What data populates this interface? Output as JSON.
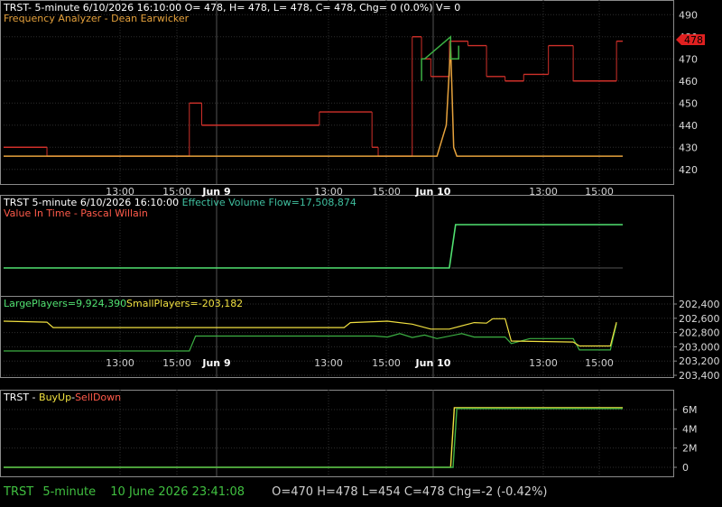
{
  "colors": {
    "background": "#000000",
    "panel_border": "#8a8a8a",
    "grid": "#2e2e2e",
    "axis_text": "#d8d8d8",
    "white": "#ffffff",
    "orange": "#e6a23c",
    "yellow": "#f0e040",
    "red": "#d0302a",
    "green": "#3cb043",
    "bright_green": "#50e070",
    "teal": "#3fbf9f",
    "salmon": "#ff5a4a",
    "status_green": "#40c040",
    "status_gray": "#cfcfcf"
  },
  "panel1": {
    "header": "TRST- 5-minute 6/10/2026 16:10:00 O= 478, H= 478, L= 478, C= 478, Chg= 0 (0.0%) V= 0",
    "subheader": "Frequency Analyzer - Dean Earwicker",
    "price_tag": "478"
  },
  "panel2": {
    "header_prefix": "TRST 5-minute  6/10/2026 16:10:00  ",
    "header_value": "Effective Volume Flow=17,508,874",
    "subheader": "Value In Time - Pascal Willain"
  },
  "panel3": {
    "large_label": "LargePlayers=9,924,390",
    "small_label": "SmallPlayers=-203,182"
  },
  "panel4": {
    "prefix": "TRST - ",
    "buy": "BuyUp",
    "dash": "-",
    "sell": "SellDown"
  },
  "status": {
    "symbol": "TRST",
    "interval": "5-minute",
    "datetime": "10 June 2026 23:41:08",
    "ohlc": "O=470  H=478  L=454  C=478  Chg=-2 (-0.42%)"
  },
  "chart_data": [
    {
      "type": "line",
      "title": "Frequency Analyzer - Dean Earwicker",
      "y_ticks": [
        420,
        430,
        440,
        450,
        460,
        470,
        480,
        490
      ],
      "ylim": [
        415,
        495
      ],
      "x_ticks": [
        "13:00",
        "15:00",
        "Jun 9",
        "13:00",
        "15:00",
        "Jun 10",
        "13:00",
        "15:00"
      ],
      "grid": true,
      "last_value": 478,
      "series": [
        {
          "color": "red",
          "kind": "price_steps",
          "segments": [
            {
              "x0": 0.0,
              "x1": 0.07,
              "y": 430
            },
            {
              "x0": 0.07,
              "x1": 0.3,
              "y": 426
            },
            {
              "x0": 0.3,
              "x1": 0.32,
              "y": 450
            },
            {
              "x0": 0.32,
              "x1": 0.51,
              "y": 440
            },
            {
              "x0": 0.51,
              "x1": 0.595,
              "y": 446
            },
            {
              "x0": 0.595,
              "x1": 0.605,
              "y": 430
            },
            {
              "x0": 0.605,
              "x1": 0.66,
              "y": 426
            },
            {
              "x0": 0.66,
              "x1": 0.675,
              "y": 480
            },
            {
              "x0": 0.675,
              "x1": 0.69,
              "y": 470
            },
            {
              "x0": 0.69,
              "x1": 0.72,
              "y": 462
            },
            {
              "x0": 0.72,
              "x1": 0.75,
              "y": 478
            },
            {
              "x0": 0.75,
              "x1": 0.78,
              "y": 476
            },
            {
              "x0": 0.78,
              "x1": 0.81,
              "y": 462
            },
            {
              "x0": 0.81,
              "x1": 0.84,
              "y": 460
            },
            {
              "x0": 0.84,
              "x1": 0.88,
              "y": 463
            },
            {
              "x0": 0.88,
              "x1": 0.92,
              "y": 476
            },
            {
              "x0": 0.92,
              "x1": 0.99,
              "y": 460
            },
            {
              "x0": 0.99,
              "x1": 1.0,
              "y": 478
            }
          ]
        },
        {
          "color": "orange",
          "kind": "analyzer",
          "points": [
            [
              0.0,
              426
            ],
            [
              0.7,
              426
            ],
            [
              0.715,
              440
            ],
            [
              0.722,
              476
            ],
            [
              0.727,
              430
            ],
            [
              0.732,
              426
            ],
            [
              1.0,
              426
            ]
          ]
        },
        {
          "color": "green",
          "kind": "steps",
          "points": [
            [
              0.675,
              460
            ],
            [
              0.675,
              470
            ],
            [
              0.68,
              470
            ],
            [
              0.722,
              480
            ],
            [
              0.722,
              470
            ],
            [
              0.735,
              470
            ],
            [
              0.735,
              476
            ]
          ]
        }
      ]
    },
    {
      "type": "line",
      "title": "Effective Volume Flow",
      "value": 17508874,
      "series": [
        {
          "name": "Effective Volume Flow",
          "color": "bright_green",
          "points": [
            [
              0.0,
              0
            ],
            [
              0.72,
              0
            ],
            [
              0.73,
              17508874
            ],
            [
              1.0,
              17508874
            ]
          ]
        }
      ]
    },
    {
      "type": "line",
      "title": "LargePlayers / SmallPlayers",
      "y_ticks": [
        "202,400",
        "202,600",
        "202,800",
        "203,000",
        "203,200",
        "203,400"
      ],
      "x_ticks": [
        "13:00",
        "15:00",
        "Jun 9",
        "13:00",
        "15:00",
        "Jun 10",
        "13:00",
        "15:00"
      ],
      "series": [
        {
          "name": "LargePlayers",
          "value": 9924390,
          "color": "green",
          "points": [
            [
              0.0,
              0.2
            ],
            [
              0.3,
              0.2
            ],
            [
              0.31,
              0.5
            ],
            [
              0.6,
              0.5
            ],
            [
              0.62,
              0.48
            ],
            [
              0.64,
              0.55
            ],
            [
              0.66,
              0.47
            ],
            [
              0.68,
              0.52
            ],
            [
              0.7,
              0.45
            ],
            [
              0.74,
              0.55
            ],
            [
              0.76,
              0.48
            ],
            [
              0.81,
              0.48
            ],
            [
              0.82,
              0.35
            ],
            [
              0.85,
              0.45
            ],
            [
              0.92,
              0.45
            ],
            [
              0.93,
              0.22
            ],
            [
              0.98,
              0.22
            ],
            [
              0.99,
              0.75
            ]
          ]
        },
        {
          "name": "SmallPlayers",
          "value": -203182,
          "color": "yellow",
          "points": [
            [
              0.0,
              0.8
            ],
            [
              0.07,
              0.78
            ],
            [
              0.08,
              0.67
            ],
            [
              0.55,
              0.67
            ],
            [
              0.56,
              0.77
            ],
            [
              0.62,
              0.8
            ],
            [
              0.66,
              0.74
            ],
            [
              0.69,
              0.64
            ],
            [
              0.72,
              0.64
            ],
            [
              0.76,
              0.77
            ],
            [
              0.78,
              0.76
            ],
            [
              0.79,
              0.85
            ],
            [
              0.81,
              0.85
            ],
            [
              0.82,
              0.4
            ],
            [
              0.92,
              0.38
            ],
            [
              0.93,
              0.3
            ],
            [
              0.98,
              0.3
            ],
            [
              0.99,
              0.78
            ]
          ]
        }
      ]
    },
    {
      "type": "line",
      "title": "BuyUp-SellDown",
      "y_ticks": [
        "0",
        "2M",
        "4M",
        "6M"
      ],
      "series": [
        {
          "name": "BuyUp",
          "color": "yellow",
          "points": [
            [
              0.0,
              0
            ],
            [
              0.722,
              0
            ],
            [
              0.728,
              6200000
            ],
            [
              1.0,
              6200000
            ]
          ]
        },
        {
          "name": "SellDown",
          "color": "green",
          "points": [
            [
              0.0,
              0
            ],
            [
              0.726,
              0
            ],
            [
              0.732,
              6100000
            ],
            [
              1.0,
              6100000
            ]
          ]
        }
      ]
    }
  ]
}
